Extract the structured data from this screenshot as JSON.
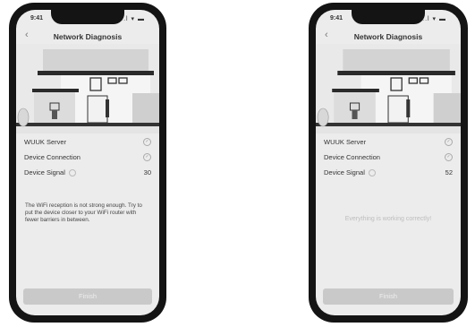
{
  "status_bar": {
    "time": "9:41",
    "icons": "..l ▾ ▬"
  },
  "screens": [
    {
      "title": "Network Diagnosis",
      "back_icon": "chevron-left-icon",
      "rows": [
        {
          "label": "WUUK Server",
          "status": "✓"
        },
        {
          "label": "Device Connection",
          "status": "✓"
        },
        {
          "label": "Device Signal",
          "value": "30"
        }
      ],
      "message": "The WiFi reception is not strong enough. Try to put the device closer to your WiFi router with fewer barriers in between.",
      "finish_label": "Finish"
    },
    {
      "title": "Network Diagnosis",
      "back_icon": "chevron-left-icon",
      "rows": [
        {
          "label": "WUUK Server",
          "status": "✓"
        },
        {
          "label": "Device Connection",
          "status": "✓"
        },
        {
          "label": "Device Signal",
          "value": "52"
        }
      ],
      "message": "Everything is working correctly!",
      "finish_label": "Finish"
    }
  ]
}
